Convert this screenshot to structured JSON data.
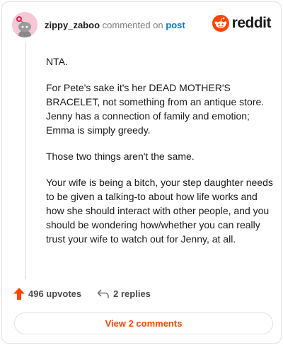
{
  "header": {
    "username": "zippy_zaboo",
    "action_text": "commented on",
    "post_link": "post"
  },
  "brand": {
    "name": "reddit",
    "icon": "reddit-alien-icon",
    "color": "#ff4500"
  },
  "avatar": {
    "icon": "snoo-avatar-icon",
    "background": "#f6c7d4"
  },
  "comment": {
    "paragraphs": [
      "NTA.",
      "For Pete's sake it's her DEAD MOTHER'S BRACELET, not something from an antique store. Jenny has a connection of family and emotion; Emma is simply greedy.",
      "Those two things aren't the same.",
      "Your wife is being a bitch, your step daughter needs to be given a talking-to about how life works and how she should interact with other people, and you should be wondering how/whether you can really trust your wife to watch out for Jenny, at all."
    ]
  },
  "actions": {
    "upvotes": "496 upvotes",
    "upvote_icon": "upvote-arrow-icon",
    "replies": "2 replies",
    "reply_icon": "reply-arrow-icon"
  },
  "view_comments": "View 2 comments"
}
